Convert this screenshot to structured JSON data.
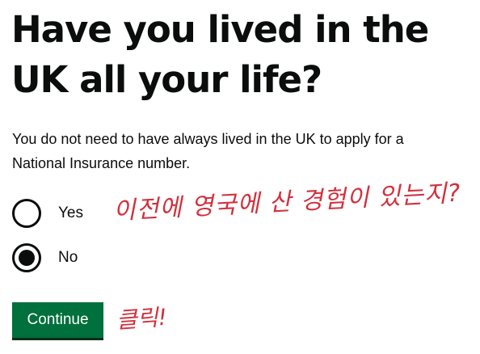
{
  "question": {
    "heading_line1": "Have you lived in the",
    "heading_line2": "UK all your life?",
    "hint_line1": "You do not need to have always lived in the UK to apply for a",
    "hint_line2": "National Insurance number."
  },
  "options": [
    {
      "label": "Yes",
      "checked": false
    },
    {
      "label": "No",
      "checked": true
    }
  ],
  "continue_label": "Continue",
  "annotations": {
    "question_note": "이전에 영국에 산 경험이 있는지?",
    "click_note": "클릭!"
  },
  "colors": {
    "text": "#0b0c0c",
    "button": "#00703c",
    "button_shadow": "#002d18",
    "annotation": "#d1313d"
  }
}
